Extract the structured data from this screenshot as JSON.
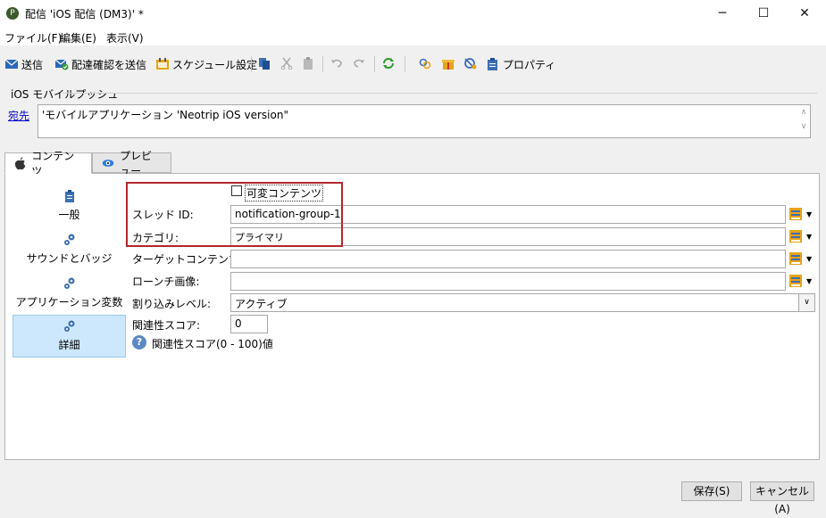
{
  "window": {
    "title": "配信 'iOS 配信 (DM3)' *",
    "app_icon_glyph": "P",
    "minimize_glyph": "─",
    "maximize_glyph": "☐",
    "close_glyph": "✕"
  },
  "menu": [
    "ファイル(F)",
    "編集(E)",
    "表示(V)"
  ],
  "toolbar": {
    "send": "送信",
    "proof": "配達確認を送信",
    "schedule": "スケジュール設定",
    "properties": "プロパティ"
  },
  "group_label": "iOS モバイルプッシュ",
  "destination": {
    "link": "宛先",
    "value": "'モバイルアプリケーション 'Neotrip iOS version\"",
    "scroll_up": "∧",
    "scroll_down": "∨"
  },
  "tabs": [
    {
      "label": "コンテンツ"
    },
    {
      "label": "プレビュー"
    }
  ],
  "sidebar": [
    {
      "label": "一般"
    },
    {
      "label": "サウンドとバッジ"
    },
    {
      "label": "アプリケーション変数"
    },
    {
      "label": "詳細"
    }
  ],
  "form": {
    "mutable_content_label": "可変コンテンツ",
    "mutable_content_checked": false,
    "thread_id_label": "スレッド ID:",
    "thread_id_value": "notification-group-1",
    "category_label": "カテゴリ:",
    "category_value": "プライマリ",
    "target_content_label": "ターゲットコンテンツ ID:",
    "target_content_value": "",
    "launch_image_label": "ローンチ画像:",
    "launch_image_value": "",
    "interruption_label": "割り込みレベル:",
    "interruption_value": "アクティブ",
    "relevance_label": "関連性スコア:",
    "relevance_value": "0",
    "help_glyph": "?",
    "help_text": "関連性スコア(0 - 100)値"
  },
  "footer": {
    "save": "保存(S)",
    "cancel": "キャンセル(A)"
  },
  "colors": {
    "highlight_border": "#b3262b",
    "selected_side": "#cde8fc",
    "link": "#0000cc"
  }
}
